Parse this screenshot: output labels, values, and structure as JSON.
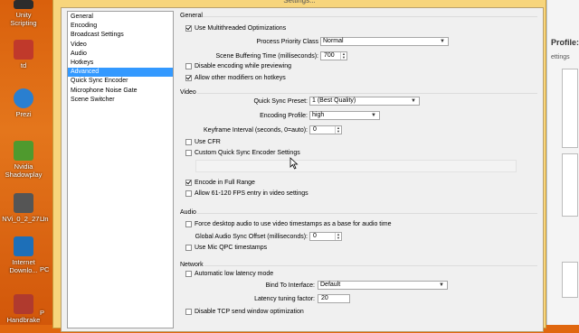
{
  "window": {
    "title": "Settings..."
  },
  "desktop_icons": [
    {
      "label": "Unity\nScripting",
      "color": "#2c2c2c"
    },
    {
      "label": "td",
      "color": "#c0392b"
    },
    {
      "label": "Prezi",
      "color": "#2a7fd0"
    },
    {
      "label": "Nvidia\nShadowplay",
      "color": "#4f9a2e"
    },
    {
      "label": "NVi_0_2_27...",
      "color": "#555555"
    },
    {
      "label": "Internet\nDownlo...",
      "color": "#1d6fb8"
    },
    {
      "label": "Handbrake",
      "color": "#b03a2e"
    }
  ],
  "desktop_partial_labels": [
    "Un",
    "PC",
    "P"
  ],
  "background_window": {
    "title": "Profile:",
    "subtitle": "ettings"
  },
  "nav": {
    "items": [
      {
        "label": "General",
        "selected": false
      },
      {
        "label": "Encoding",
        "selected": false
      },
      {
        "label": "Broadcast Settings",
        "selected": false
      },
      {
        "label": "Video",
        "selected": false
      },
      {
        "label": "Audio",
        "selected": false
      },
      {
        "label": "Hotkeys",
        "selected": false
      },
      {
        "label": "Advanced",
        "selected": true
      },
      {
        "label": "Quick Sync Encoder",
        "selected": false
      },
      {
        "label": "Microphone Noise Gate",
        "selected": false
      },
      {
        "label": "Scene Switcher",
        "selected": false
      }
    ]
  },
  "general": {
    "title": "General",
    "use_multithreaded": {
      "label": "Use Multithreaded Optimizations",
      "checked": true
    },
    "process_priority": {
      "label": "Process Priority Class",
      "value": "Normal"
    },
    "scene_buffering": {
      "label": "Scene Buffering Time (milliseconds):",
      "value": "700"
    },
    "disable_encoding": {
      "label": "Disable encoding while previewing",
      "checked": false
    },
    "allow_modifiers": {
      "label": "Allow other modifiers on hotkeys",
      "checked": true
    }
  },
  "video": {
    "title": "Video",
    "quick_sync_preset": {
      "label": "Quick Sync Preset:",
      "value": "1 (Best Quality)"
    },
    "encoding_profile": {
      "label": "Encoding Profile:",
      "value": "high"
    },
    "keyframe_interval": {
      "label": "Keyframe Interval (seconds, 0=auto):",
      "value": "0"
    },
    "use_cfr": {
      "label": "Use CFR",
      "checked": false
    },
    "custom_qs": {
      "label": "Custom Quick Sync Encoder Settings",
      "checked": false
    },
    "encode_full_range": {
      "label": "Encode in Full Range",
      "checked": true
    },
    "allow_fps": {
      "label": "Allow 61-120 FPS entry in video settings",
      "checked": false
    }
  },
  "audio": {
    "title": "Audio",
    "force_desktop_ts": {
      "label": "Force desktop audio to use video timestamps as a base for audio time",
      "checked": false
    },
    "sync_offset": {
      "label": "Global Audio Sync Offset (milliseconds):",
      "value": "0"
    },
    "mic_qpc": {
      "label": "Use Mic QPC timestamps",
      "checked": false
    }
  },
  "network": {
    "title": "Network",
    "auto_low_latency": {
      "label": "Automatic low latency mode",
      "checked": false
    },
    "bind_interface": {
      "label": "Bind To Interface:",
      "value": "Default"
    },
    "latency_factor": {
      "label": "Latency tuning factor:",
      "value": "20"
    },
    "disable_tcp": {
      "label": "Disable TCP send window optimization",
      "checked": false
    }
  }
}
